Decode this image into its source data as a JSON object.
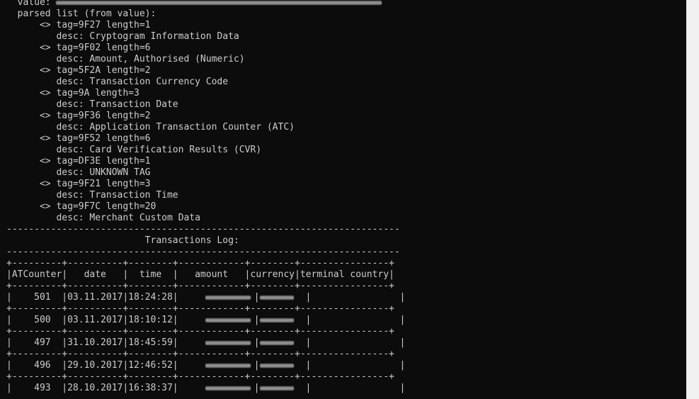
{
  "console": {
    "value_label": "  value: ",
    "parsed_header": "  parsed list (from value):",
    "tags": [
      {
        "tag_line": "      <> tag=9F27 length=1",
        "desc_line": "         desc: Cryptogram Information Data"
      },
      {
        "tag_line": "      <> tag=9F02 length=6",
        "desc_line": "         desc: Amount, Authorised (Numeric)"
      },
      {
        "tag_line": "      <> tag=5F2A length=2",
        "desc_line": "         desc: Transaction Currency Code"
      },
      {
        "tag_line": "      <> tag=9A length=3",
        "desc_line": "         desc: Transaction Date"
      },
      {
        "tag_line": "      <> tag=9F36 length=2",
        "desc_line": "         desc: Application Transaction Counter (ATC)"
      },
      {
        "tag_line": "      <> tag=9F52 length=6",
        "desc_line": "         desc: Card Verification Results (CVR)"
      },
      {
        "tag_line": "      <> tag=DF3E length=1",
        "desc_line": "         desc: UNKNOWN TAG"
      },
      {
        "tag_line": "      <> tag=9F21 length=3",
        "desc_line": "         desc: Transaction Time"
      },
      {
        "tag_line": "      <> tag=9F7C length=20",
        "desc_line": "         desc: Merchant Custom Data"
      }
    ],
    "dash_rule": "-----------------------------------------------------------------------",
    "log_title": "                         Transactions Log:",
    "table_border": "+---------+----------+--------+------------+--------+----------------+",
    "table_header": "|ATCounter|   date   |  time  |   amount   |currency|terminal country|",
    "rows": [
      {
        "prefix": "|    501  |03.11.2017|18:24:28|",
        "mid": "|",
        "suffix": "|                |"
      },
      {
        "prefix": "|    500  |03.11.2017|18:10:12|",
        "mid": "|",
        "suffix": "|                |"
      },
      {
        "prefix": "|    497  |31.10.2017|18:45:59|",
        "mid": "|",
        "suffix": "|                |"
      },
      {
        "prefix": "|    496  |29.10.2017|12:46:52|",
        "mid": "|",
        "suffix": "|                |"
      },
      {
        "prefix": "|    493  |28.10.2017|16:38:37|",
        "mid": "|",
        "suffix": "|                |"
      }
    ]
  }
}
